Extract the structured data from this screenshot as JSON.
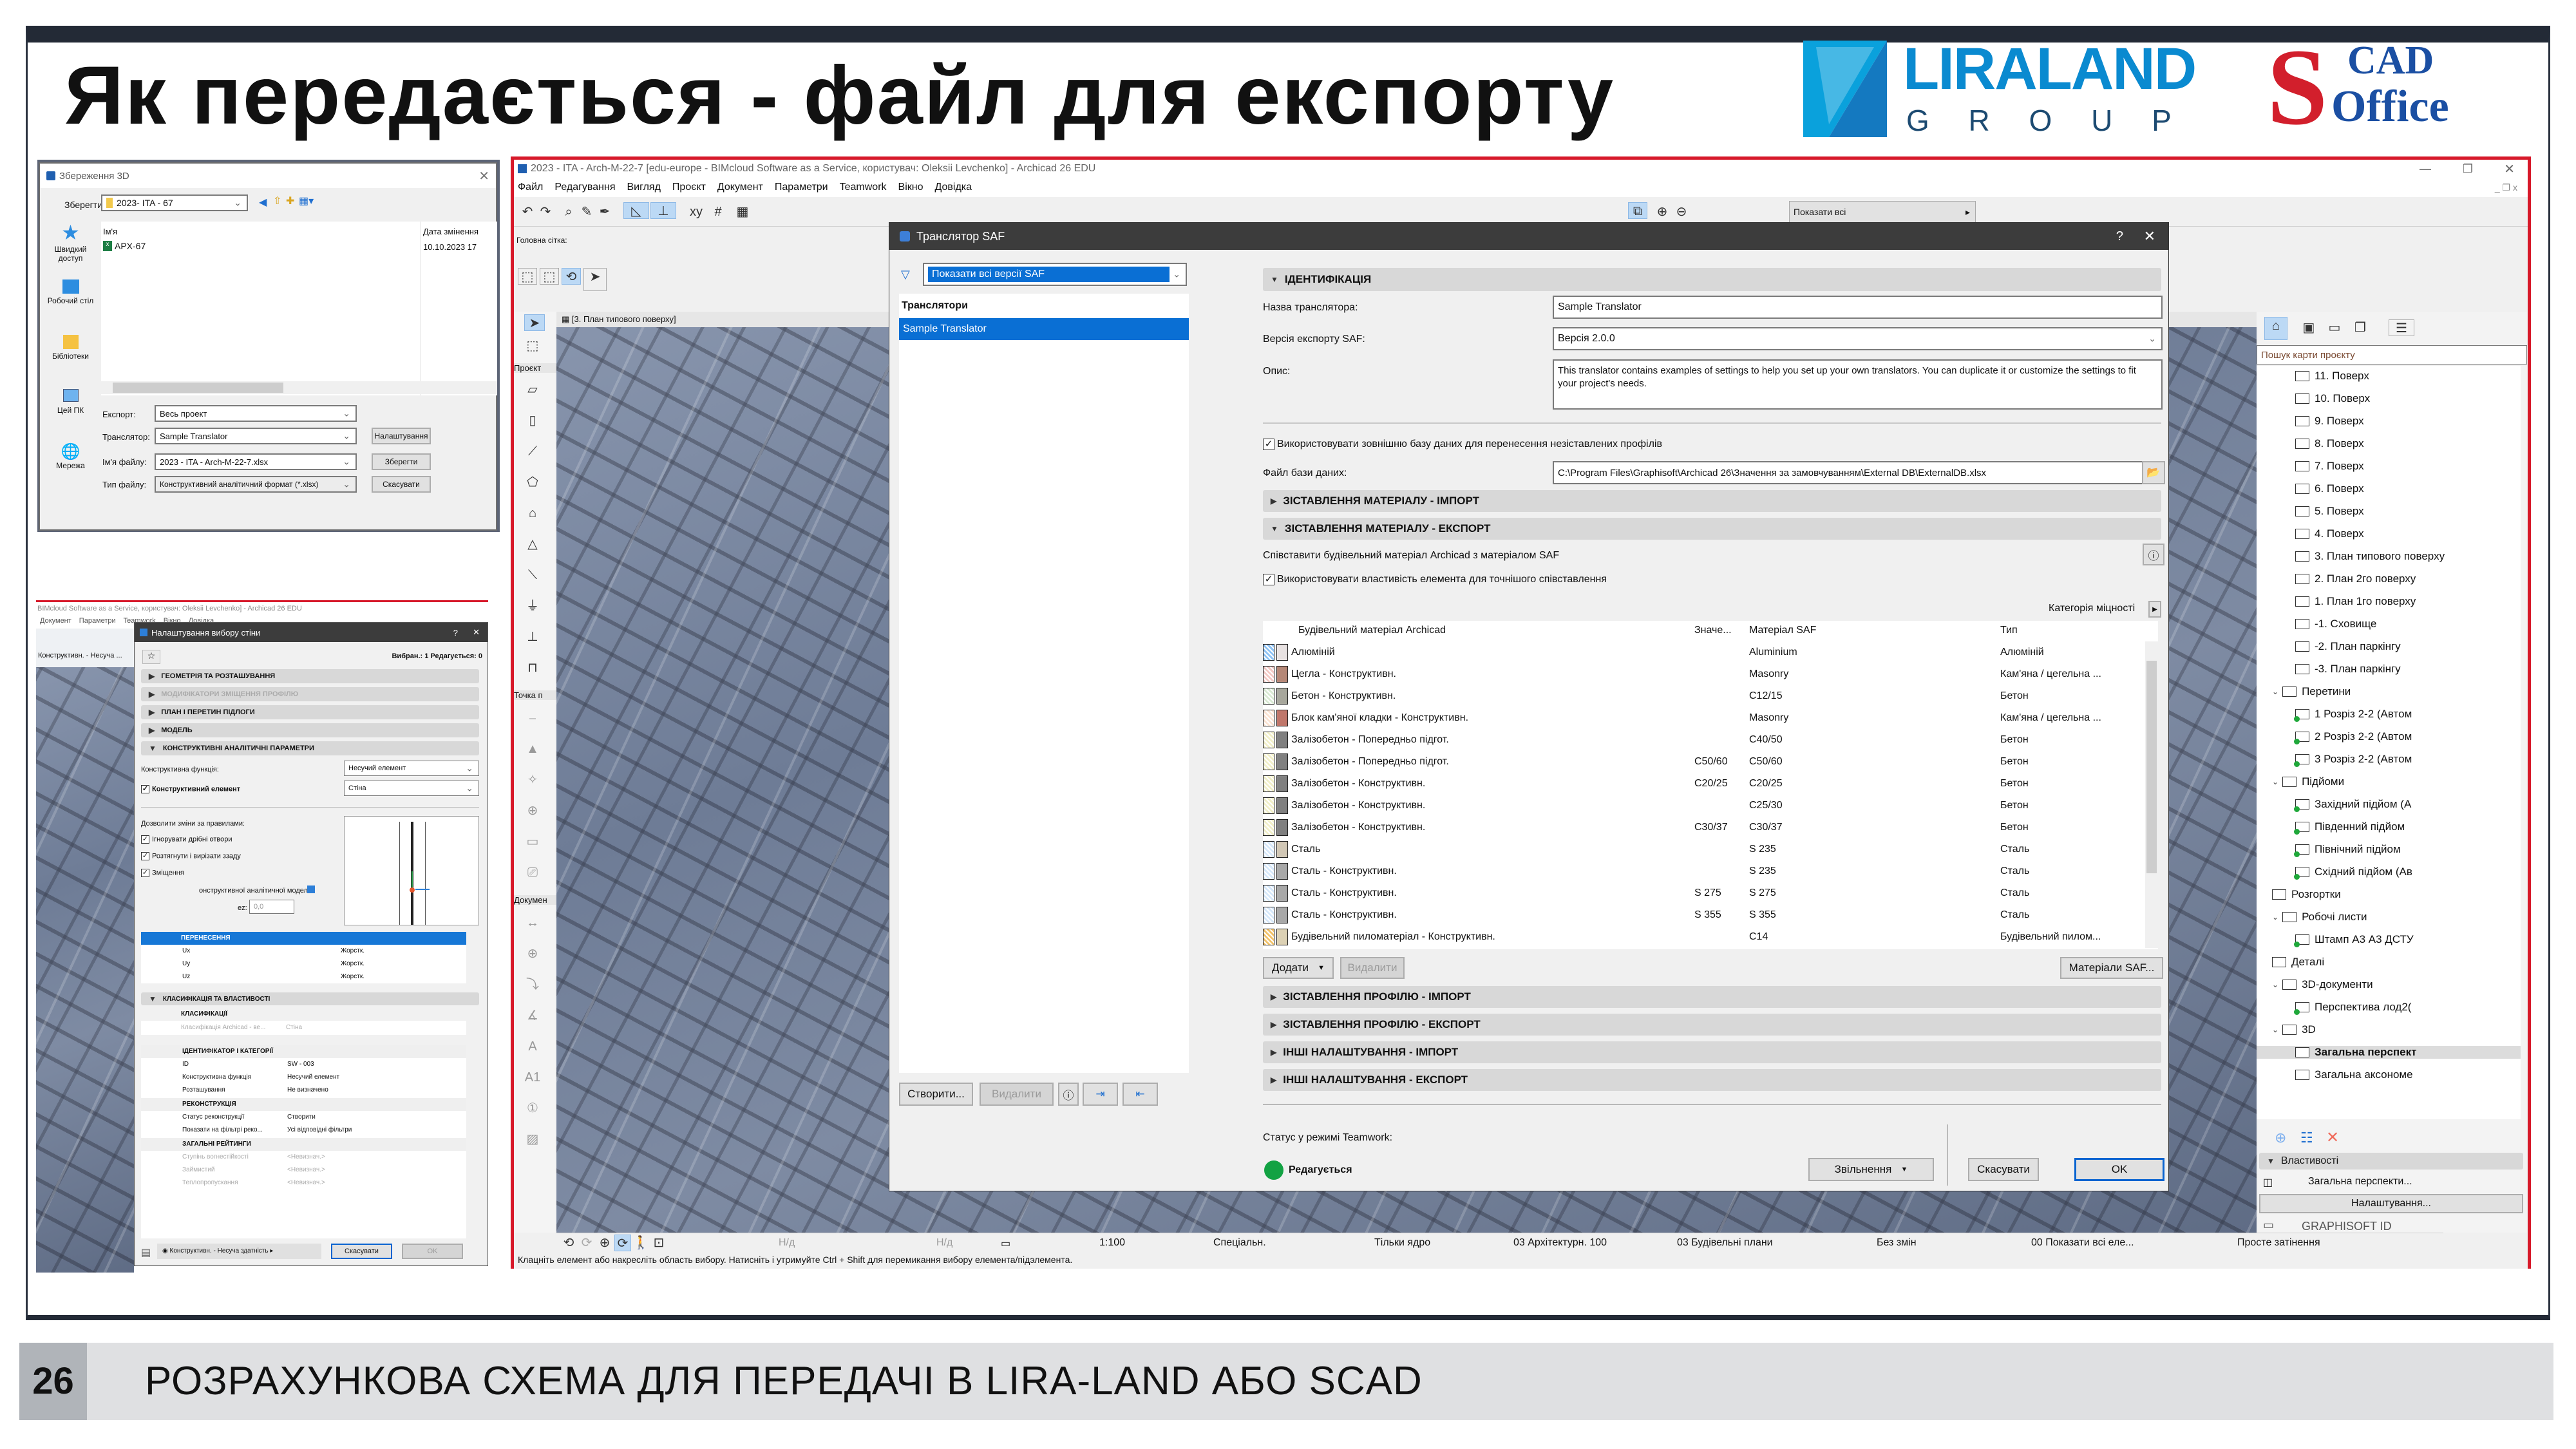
{
  "slide": {
    "title": "Як передається - файл для експорту",
    "logos": {
      "liraland_main": "LIRALAND",
      "liraland_sub": "G R O U P",
      "scad_top": "CAD",
      "scad_bottom": "Office",
      "scad_letter": "S"
    },
    "footer_number": "26",
    "footer_text": "РОЗРАХУНКОВА СХЕМА ДЛЯ ПЕРЕДАЧІ В LIRA-LAND АБО SCAD",
    "colors": {
      "frame": "#232a36",
      "highlight_border": "#d7192a",
      "liraland_blue": "#0a8ad0",
      "scad_red": "#d21f2c",
      "scad_blue": "#1b4fa3"
    }
  },
  "save_dialog": {
    "title": "Збереження 3D",
    "save_in_label": "Зберегти у:",
    "save_in_value": "2023- ITA - 67",
    "places": [
      "Швидкий доступ",
      "Робочий стіл",
      "Бібліотеки",
      "Цей ПК",
      "Мережа"
    ],
    "columns": {
      "name": "Ім'я",
      "date": "Дата змінення"
    },
    "files": [
      {
        "name": "APX-67",
        "date": "10.10.2023 17"
      }
    ],
    "export_label": "Експорт:",
    "export_value": "Весь проект",
    "translator_label": "Транслятор:",
    "translator_value": "Sample Translator",
    "filename_label": "Ім'я файлу:",
    "filename_value": "2023 - ITA - Arch-M-22-7.xlsx",
    "filetype_label": "Тип файлу:",
    "filetype_value": "Конструктивний аналітичний формат (*.xlsx)",
    "settings_button": "Налаштування",
    "save_button": "Зберегти",
    "cancel_button": "Скасувати"
  },
  "wall_dialog": {
    "bg_title": "BIMcloud Software as a Service, користувач: Oleksii Levchenko] - Archicad 26 EDU",
    "bg_menu": [
      "Документ",
      "Параметри",
      "Teamwork",
      "Вікно",
      "Довідка"
    ],
    "bg_layer": "Конструктивн. - Несуча ...",
    "title": "Налаштування вибору стіни",
    "selected_info": "Вибран.: 1 Редагується: 0",
    "sections": [
      "ГЕОМЕТРІЯ ТА РОЗТАШУВАННЯ",
      "МОДИФІКАТОРИ ЗМІЩЕННЯ ПРОФІЛЮ",
      "ПЛАН І ПЕРЕТИН ПІДЛОГИ",
      "МОДЕЛЬ",
      "КОНСТРУКТИВНІ АНАЛІТИЧНІ ПАРАМЕТРИ"
    ],
    "structural_function_label": "Конструктивна функція:",
    "structural_function_value": "Несучий елемент",
    "structural_element_label": "Конструктивний елемент",
    "structural_element_value": "Стіна",
    "allow_rules_label": "Дозволити зміни за правилами:",
    "rules": [
      "Ігнорувати дрібні отвори",
      "Розтягнути і вирізати ззаду",
      "Зміщення"
    ],
    "analytic_model_label": "онструктивної аналітичної моделі",
    "ez_label": "ez:",
    "ez_value": "0,0",
    "transfer_header": "ПЕРЕНЕСЕННЯ",
    "transfer_rows": [
      {
        "k": "Ux",
        "v": "Жорстк."
      },
      {
        "k": "Uy",
        "v": "Жорстк."
      },
      {
        "k": "Uz",
        "v": "Жорстк."
      }
    ],
    "class_header": "КЛАСИФІКАЦІЯ ТА ВЛАСТИВОСТІ",
    "classifications_header": "КЛАСИФІКАЦІЇ",
    "classification_row": {
      "k": "Класифікація Archicad - ве...",
      "v": "Стіна"
    },
    "id_header": "ІДЕНТИФІКАТОР І КАТЕГОРІЇ",
    "id_rows": [
      {
        "k": "ID",
        "v": "SW - 003"
      },
      {
        "k": "Конструктивна функція",
        "v": "Несучий елемент"
      },
      {
        "k": "Розташування",
        "v": "Не визначено"
      }
    ],
    "reconstruction_header": "РЕКОНСТРУКЦІЯ",
    "reconstruction_rows": [
      {
        "k": "Статус реконструкції",
        "v": "Створити"
      },
      {
        "k": "Показати на фільтрі реко...",
        "v": "Усі відповідні фільтри"
      }
    ],
    "ratings_header": "ЗАГАЛЬНІ РЕЙТИНГИ",
    "ratings_rows": [
      {
        "k": "Ступінь вогнестійкості",
        "v": "<Невизнач.>"
      },
      {
        "k": "Займистий",
        "v": "<Невизнач.>"
      },
      {
        "k": "Теплопропускання",
        "v": "<Невизнач.>"
      }
    ],
    "layer_value": "Конструктивн. - Несуча здатність",
    "cancel_button": "Скасувати",
    "ok_button": "OK"
  },
  "archicad": {
    "title": "2023 - ITA - Arch-M-22-7 [edu-europe - BIMcloud Software as a Service, користувач: Oleksii Levchenko] - Archicad 26 EDU",
    "menu": [
      "Файл",
      "Редагування",
      "Вигляд",
      "Проєкт",
      "Документ",
      "Параметри",
      "Teamwork",
      "Вікно",
      "Довідка"
    ],
    "main_grid_label": "Головна сітка:",
    "view_tab": "[3. План типового поверху]",
    "show_all_dropdown": "Показати всі",
    "toolbox_headers": [
      "Проєкт",
      "Точка п",
      "Докумен"
    ],
    "status_message": "Клацніть елемент або накресліть область вибору. Натисніть і утримуйте Ctrl + Shift для перемикання вибору елемента/підэлемента.",
    "statusbar": {
      "na1": "Н/д",
      "na2": "Н/д",
      "scale": "1:100",
      "layer_combo": "Спеціальн.",
      "structure": "Тільки ядро",
      "pen_set": "03 Архітектурн. 100",
      "model_view": "03 Будівельні плани",
      "override": "Без змін",
      "renovation": "00 Показати всі еле...",
      "shading": "Просте затінення"
    },
    "navigator": {
      "search_placeholder": "Пошук карти проєкту",
      "stories": [
        "11. Поверх",
        "10. Поверх",
        "9. Поверх",
        "8. Поверх",
        "7. Поверх",
        "6. Поверх",
        "5. Поверх",
        "4. Поверх",
        "3. План типового поверху",
        "2. План 2го поверху",
        "1. План 1го поверху",
        "-1. Сховище",
        "-2. План паркінгу",
        "-3. План паркінгу"
      ],
      "sections_folder": "Перетини",
      "sections": [
        "1 Розріз 2-2 (Автом",
        "2 Розріз 2-2 (Автом",
        "3 Розріз 2-2 (Автом"
      ],
      "elevations_folder": "Підйоми",
      "elevations": [
        "Західний підйом (А",
        "Південний підйом",
        "Північний підйом",
        "Східний підйом (Ав"
      ],
      "interior_elevations": "Розгортки",
      "worksheets_folder": "Робочі листи",
      "worksheets": [
        "Штамп А3 А3 ДСТУ"
      ],
      "details": "Деталі",
      "docs3d_folder": "3D-документи",
      "docs3d": [
        "Перспектива лод2("
      ],
      "folder3d": "3D",
      "items3d": [
        "Загальна перспект",
        "Загальна аксономе"
      ],
      "properties_header": "Властивості",
      "properties_value": "Загальна перспекти...",
      "settings_button": "Налаштування...",
      "graphisoft_id": "GRAPHISOFT ID"
    }
  },
  "saf_dialog": {
    "title": "Транслятор SAF",
    "filter_value": "Показати всі версії SAF",
    "list_header": "Транслятори",
    "translators": [
      "Sample Translator"
    ],
    "buttons_left": {
      "create": "Створити...",
      "delete": "Видалити"
    },
    "identification_header": "ІДЕНТИФІКАЦІЯ",
    "name_label": "Назва транслятора:",
    "name_value": "Sample Translator",
    "version_label": "Версія експорту SAF:",
    "version_value": "Версія 2.0.0",
    "description_label": "Опис:",
    "description_value": "This translator contains examples of settings to help you set up your own translators. You can duplicate it or customize the settings to fit your project's needs.",
    "use_external_db_label": "Використовувати зовнішню базу даних для перенесення незіставлених профілів",
    "db_file_label": "Файл бази даних:",
    "db_file_value": "C:\\Program Files\\Graphisoft\\Archicad 26\\Значення за замовчуванням\\External DB\\ExternalDB.xlsx",
    "material_import_header": "ЗІСТАВЛЕННЯ МАТЕРІАЛУ - ІМПОРТ",
    "material_export_header": "ЗІСТАВЛЕННЯ МАТЕРІАЛУ - ЕКСПОРТ",
    "map_material_label": "Співставити будівельний матеріал Archicad з матеріалом SAF",
    "use_property_label": "Використовувати властивість елемента для точнішого співставлення",
    "strength_category": "Категорія міцності",
    "table_columns": [
      "Будівельний матеріал Archicad",
      "Значе...",
      "Матеріал SAF",
      "Тип"
    ],
    "materials": [
      {
        "name": "Алюміній",
        "value": "",
        "saf": "Aluminium",
        "type": "Алюміній",
        "hatch": "#8ec3f5",
        "fill": "#e8e2e2"
      },
      {
        "name": "Цегла - Конструктивн.",
        "value": "",
        "saf": "Masonry",
        "type": "Кам'яна / цегельна ...",
        "hatch": "#f3c9c4",
        "fill": "#b58776"
      },
      {
        "name": "Бетон - Конструктивн.",
        "value": "",
        "saf": "C12/15",
        "type": "Бетон",
        "hatch": "#d9ead3",
        "fill": "#a7a79c"
      },
      {
        "name": "Блок кам'яної кладки - Конструктивн.",
        "value": "",
        "saf": "Masonry",
        "type": "Кам'яна / цегельна ...",
        "hatch": "#fbe3d2",
        "fill": "#c0776b"
      },
      {
        "name": "Залізобетон - Попередньо підгот.",
        "value": "",
        "saf": "C40/50",
        "type": "Бетон",
        "hatch": "#f1efc8",
        "fill": "#808080"
      },
      {
        "name": "Залізобетон - Попередньо підгот.",
        "value": "C50/60",
        "saf": "C50/60",
        "type": "Бетон",
        "hatch": "#f1efc8",
        "fill": "#808080"
      },
      {
        "name": "Залізобетон - Конструктивн.",
        "value": "C20/25",
        "saf": "C20/25",
        "type": "Бетон",
        "hatch": "#f1efc8",
        "fill": "#808080"
      },
      {
        "name": "Залізобетон - Конструктивн.",
        "value": "",
        "saf": "C25/30",
        "type": "Бетон",
        "hatch": "#f1efc8",
        "fill": "#808080"
      },
      {
        "name": "Залізобетон - Конструктивн.",
        "value": "C30/37",
        "saf": "C30/37",
        "type": "Бетон",
        "hatch": "#f1efc8",
        "fill": "#808080"
      },
      {
        "name": "Сталь",
        "value": "",
        "saf": "S 235",
        "type": "Сталь",
        "hatch": "#d6e8fa",
        "fill": "#d1c7b5"
      },
      {
        "name": "Сталь - Конструктивн.",
        "value": "",
        "saf": "S 235",
        "type": "Сталь",
        "hatch": "#d6e8fa",
        "fill": "#a8a8a8"
      },
      {
        "name": "Сталь - Конструктивн.",
        "value": "S 275",
        "saf": "S 275",
        "type": "Сталь",
        "hatch": "#d6e8fa",
        "fill": "#a8a8a8"
      },
      {
        "name": "Сталь - Конструктивн.",
        "value": "S 355",
        "saf": "S 355",
        "type": "Сталь",
        "hatch": "#d6e8fa",
        "fill": "#a8a8a8"
      },
      {
        "name": "Будівельний пиломатеріал - Конструктивн.",
        "value": "",
        "saf": "C14",
        "type": "Будівельний пилом...",
        "hatch": "#f2c36a",
        "fill": "#dcd1b4"
      }
    ],
    "add_button": "Додати",
    "remove_button": "Видалити",
    "saf_materials_button": "Матеріали SAF...",
    "profile_import_header": "ЗІСТАВЛЕННЯ ПРОФІЛЮ - ІМПОРТ",
    "profile_export_header": "ЗІСТАВЛЕННЯ ПРОФІЛЮ - ЕКСПОРТ",
    "other_import_header": "ІНШІ НАЛАШТУВАННЯ - ІМПОРТ",
    "other_export_header": "ІНШІ НАЛАШТУВАННЯ - ЕКСПОРТ",
    "teamwork_status_label": "Статус у режимі Teamwork:",
    "teamwork_status_value": "Редагується",
    "release_button": "Звільнення",
    "cancel_button": "Скасувати",
    "ok_button": "OK"
  }
}
